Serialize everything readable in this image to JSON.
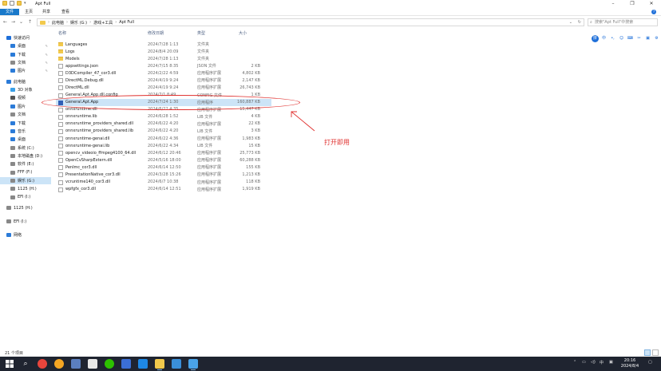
{
  "window": {
    "title": "Apt Full"
  },
  "ribbon": {
    "tabs": [
      "文件",
      "主页",
      "共享",
      "查看"
    ]
  },
  "address": {
    "crumbs": [
      "此电脑",
      "娱乐 (G:)",
      "游戏+工具",
      "Apt Full"
    ],
    "search_placeholder": "搜索\"Apt Full\"中搜索"
  },
  "sidebar": {
    "items": [
      {
        "label": "快速访问",
        "icon": "star-icon",
        "color": "#1e6fd9",
        "indent": 0
      },
      {
        "label": "桌面",
        "icon": "desktop-icon",
        "color": "#2b7bd8",
        "indent": 1,
        "pin": true
      },
      {
        "label": "下载",
        "icon": "download-icon",
        "color": "#2b7bd8",
        "indent": 1,
        "pin": true
      },
      {
        "label": "文档",
        "icon": "document-icon",
        "color": "#8a8a8a",
        "indent": 1,
        "pin": true
      },
      {
        "label": "图片",
        "icon": "picture-icon",
        "color": "#2b7bd8",
        "indent": 1,
        "pin": true
      },
      {
        "label": "此电脑",
        "icon": "computer-icon",
        "color": "#2b7bd8",
        "indent": 0
      },
      {
        "label": "3D 对象",
        "icon": "cube-icon",
        "color": "#3aa0e8",
        "indent": 1
      },
      {
        "label": "视频",
        "icon": "video-icon",
        "color": "#555555",
        "indent": 1
      },
      {
        "label": "图片",
        "icon": "picture-icon",
        "color": "#2b7bd8",
        "indent": 1
      },
      {
        "label": "文档",
        "icon": "document-icon",
        "color": "#8a8a8a",
        "indent": 1
      },
      {
        "label": "下载",
        "icon": "download-icon",
        "color": "#2b7bd8",
        "indent": 1
      },
      {
        "label": "音乐",
        "icon": "music-icon",
        "color": "#2b7bd8",
        "indent": 1
      },
      {
        "label": "桌面",
        "icon": "desktop-icon",
        "color": "#2b7bd8",
        "indent": 1
      },
      {
        "label": "系统 (C:)",
        "icon": "drive-icon",
        "color": "#888888",
        "indent": 1
      },
      {
        "label": "本地磁盘 (D:)",
        "icon": "drive-icon",
        "color": "#888888",
        "indent": 1
      },
      {
        "label": "软件 (E:)",
        "icon": "drive-icon",
        "color": "#888888",
        "indent": 1
      },
      {
        "label": "FFF (F:)",
        "icon": "drive-icon",
        "color": "#888888",
        "indent": 1
      },
      {
        "label": "娱乐 (G:)",
        "icon": "drive-icon",
        "color": "#888888",
        "indent": 1,
        "selected": true
      },
      {
        "label": "1125 (H:)",
        "icon": "drive-icon",
        "color": "#888888",
        "indent": 1
      },
      {
        "label": "EFI (I:)",
        "icon": "drive-icon",
        "color": "#888888",
        "indent": 1
      },
      {
        "label": "1125 (H:)",
        "icon": "drive-icon",
        "color": "#888888",
        "indent": 0,
        "gap": true
      },
      {
        "label": "EFI (I:)",
        "icon": "drive-icon",
        "color": "#888888",
        "indent": 0,
        "gap": true
      },
      {
        "label": "网络",
        "icon": "network-icon",
        "color": "#2b7bd8",
        "indent": 0,
        "gap": true
      }
    ]
  },
  "columns": {
    "name": "名称",
    "date": "修改日期",
    "type": "类型",
    "size": "大小"
  },
  "files": [
    {
      "name": "Languages",
      "date": "2024/7/28 1:13",
      "type": "文件夹",
      "size": "",
      "kind": "folder"
    },
    {
      "name": "Logs",
      "date": "2024/8/4 20:09",
      "type": "文件夹",
      "size": "",
      "kind": "folder"
    },
    {
      "name": "Models",
      "date": "2024/7/28 1:13",
      "type": "文件夹",
      "size": "",
      "kind": "folder"
    },
    {
      "name": "appsettings.json",
      "date": "2024/7/15 8:35",
      "type": "JSON 文件",
      "size": "2 KB",
      "kind": "doc"
    },
    {
      "name": "D3DCompiler_47_cor3.dll",
      "date": "2024/2/22 4:59",
      "type": "应用程序扩展",
      "size": "4,802 KB",
      "kind": "doc"
    },
    {
      "name": "DirectML.Debug.dll",
      "date": "2024/4/19 9:24",
      "type": "应用程序扩展",
      "size": "2,147 KB",
      "kind": "doc"
    },
    {
      "name": "DirectML.dll",
      "date": "2024/4/19 9:24",
      "type": "应用程序扩展",
      "size": "26,743 KB",
      "kind": "doc"
    },
    {
      "name": "General.Apt.App.dll.config",
      "date": "2024/7/1 8:49",
      "type": "CONFIG 文件",
      "size": "1 KB",
      "kind": "doc"
    },
    {
      "name": "General.Apt.App",
      "date": "2024/7/24 1:30",
      "type": "应用程序",
      "size": "160,887 KB",
      "kind": "app",
      "selected": true
    },
    {
      "name": "onnxruntime.dll",
      "date": "2024/6/22 4:35",
      "type": "应用程序扩展",
      "size": "15,447 KB",
      "kind": "doc"
    },
    {
      "name": "onnxruntime.lib",
      "date": "2024/6/28 1:52",
      "type": "LIB 文件",
      "size": "4 KB",
      "kind": "doc"
    },
    {
      "name": "onnxruntime_providers_shared.dll",
      "date": "2024/6/22 4:20",
      "type": "应用程序扩展",
      "size": "22 KB",
      "kind": "doc"
    },
    {
      "name": "onnxruntime_providers_shared.lib",
      "date": "2024/6/22 4:20",
      "type": "LIB 文件",
      "size": "3 KB",
      "kind": "doc"
    },
    {
      "name": "onnxruntime-genai.dll",
      "date": "2024/6/22 4:36",
      "type": "应用程序扩展",
      "size": "1,983 KB",
      "kind": "doc"
    },
    {
      "name": "onnxruntime-genai.lib",
      "date": "2024/6/22 4:34",
      "type": "LIB 文件",
      "size": "15 KB",
      "kind": "doc"
    },
    {
      "name": "opencv_videoio_ffmpeg4100_64.dll",
      "date": "2024/6/12 20:46",
      "type": "应用程序扩展",
      "size": "25,773 KB",
      "kind": "doc"
    },
    {
      "name": "OpenCvSharpExtern.dll",
      "date": "2024/5/16 18:00",
      "type": "应用程序扩展",
      "size": "60,288 KB",
      "kind": "doc"
    },
    {
      "name": "PenImc_cor3.dll",
      "date": "2024/6/14 12:50",
      "type": "应用程序扩展",
      "size": "155 KB",
      "kind": "doc"
    },
    {
      "name": "PresentationNative_cor3.dll",
      "date": "2024/3/28 15:26",
      "type": "应用程序扩展",
      "size": "1,213 KB",
      "kind": "doc"
    },
    {
      "name": "vcruntime140_cor3.dll",
      "date": "2024/6/7 10:38",
      "type": "应用程序扩展",
      "size": "118 KB",
      "kind": "doc"
    },
    {
      "name": "wpfgfx_cor3.dll",
      "date": "2024/6/14 12:51",
      "type": "应用程序扩展",
      "size": "1,919 KB",
      "kind": "doc"
    }
  ],
  "annotation": {
    "text": "打开即用",
    "color": "#e0312f"
  },
  "ime": {
    "keys": [
      "拼",
      "中",
      "•,",
      "☺",
      "⌨",
      "✂",
      "▣",
      "⚙"
    ]
  },
  "status": {
    "count": "21 个项目"
  },
  "clock": {
    "time": "20:16",
    "date": "2024/8/4"
  },
  "tray": {
    "ime_label": "中"
  }
}
